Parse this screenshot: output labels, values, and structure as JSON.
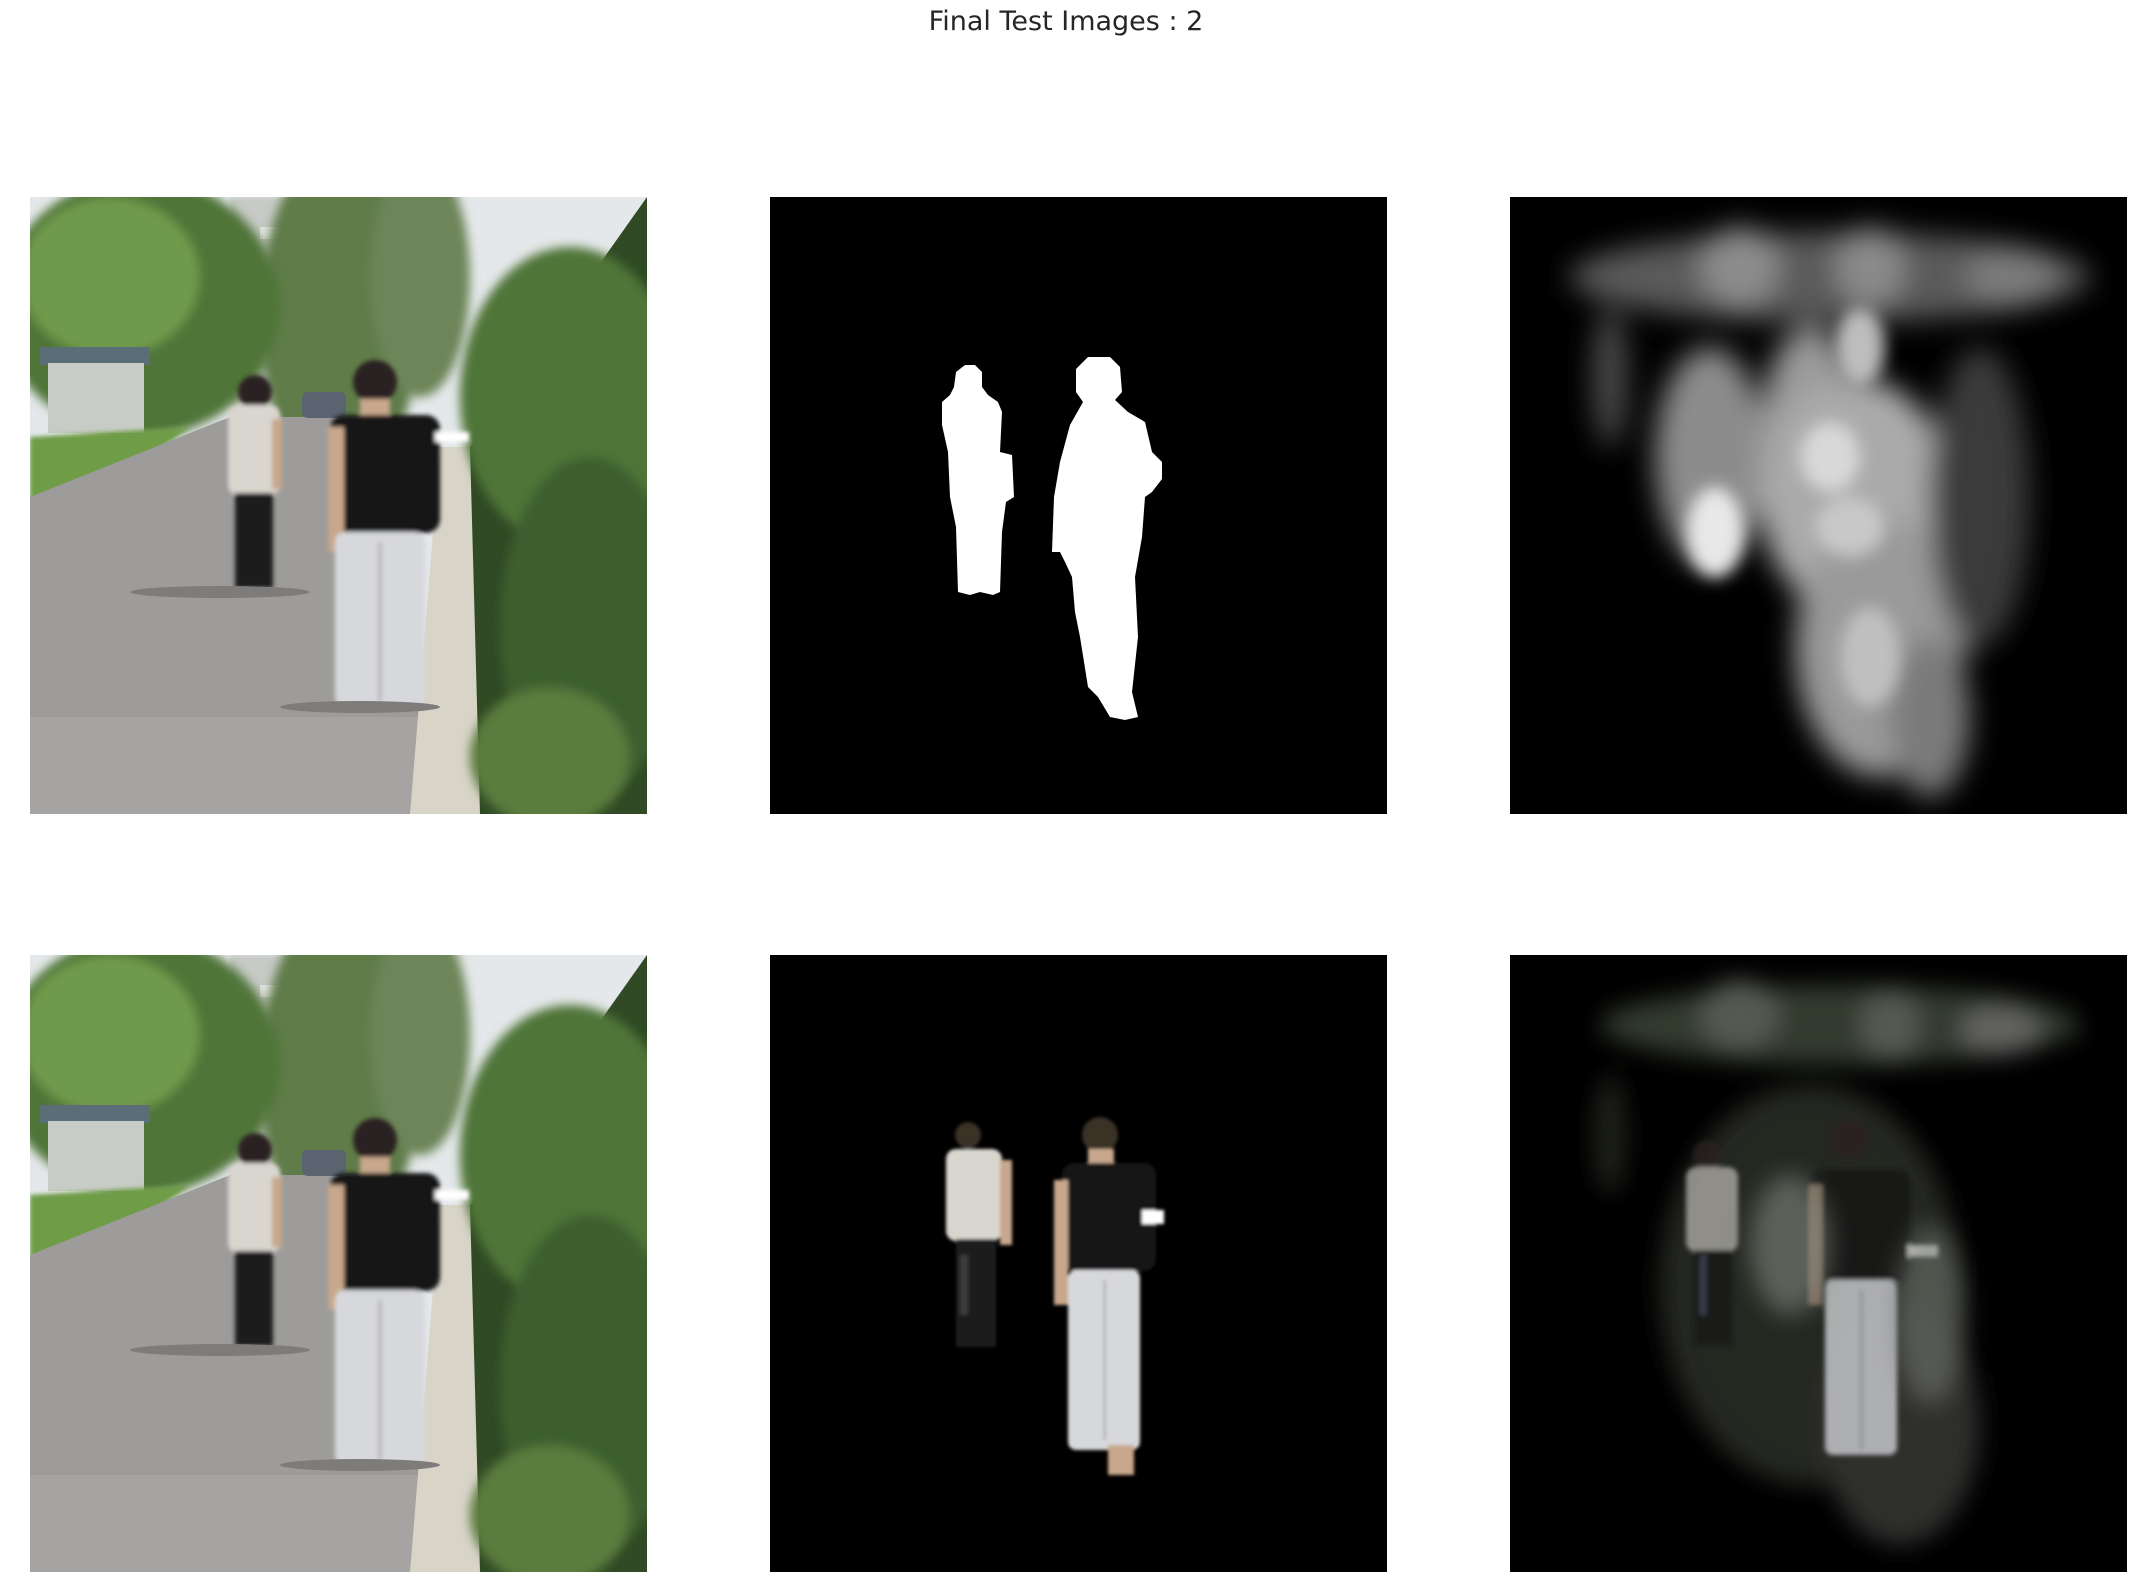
{
  "figure": {
    "title": "Final Test Images : 2"
  },
  "colors": {
    "background": "#ffffff",
    "title_text": "#262626",
    "foliage_dark": "#2f4a24",
    "foliage_mid": "#4f7438",
    "foliage_light": "#7fa35a",
    "sky": "#e4e8ea",
    "road": "#9d9c9a",
    "curb": "#d8d4c8",
    "shirt_black": "#141414",
    "pants_white": "#d7d8dc",
    "mask_white": "#ffffff",
    "mask_black": "#000000"
  },
  "panels": {
    "row1": [
      "input-image",
      "ground-truth-mask",
      "predicted-saliency-map"
    ],
    "row2": [
      "input-image",
      "ground-truth-masked-image",
      "prediction-masked-image"
    ]
  }
}
